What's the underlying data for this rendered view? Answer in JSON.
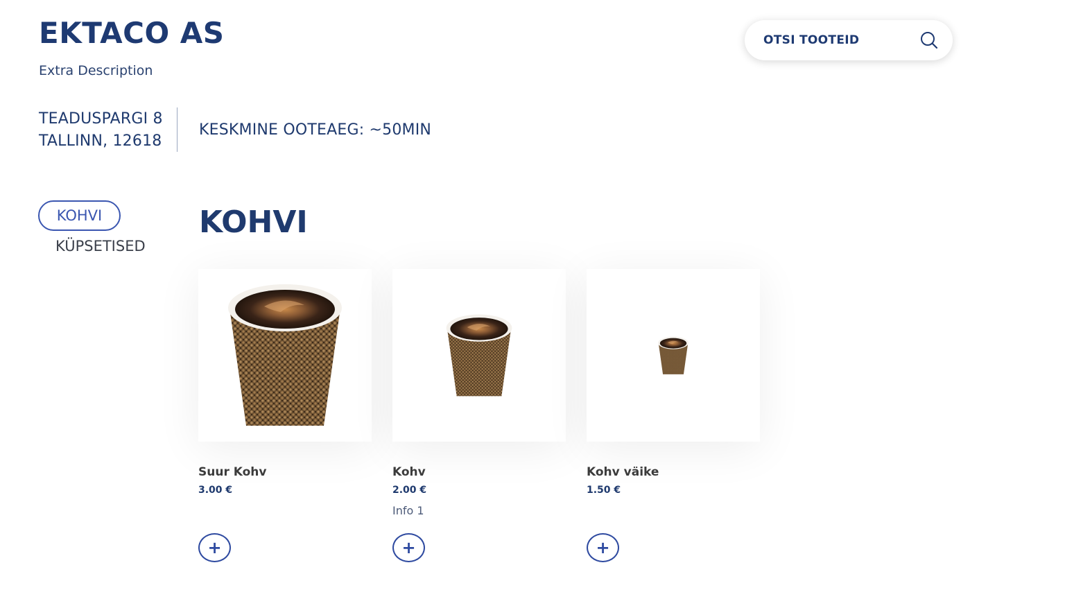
{
  "header": {
    "title": "EKTACO AS",
    "description": "Extra Description"
  },
  "search": {
    "label": "OTSI TOOTEID",
    "icon": "search-icon"
  },
  "location": {
    "address_line1": "TEADUSPARGI 8",
    "address_line2": "TALLINN, 12618",
    "wait_time": "KESKMINE OOTEAEG: ~50MIN"
  },
  "categories": [
    {
      "label": "KOHVI",
      "active": true
    },
    {
      "label": "KÜPSETISED",
      "active": false
    }
  ],
  "section": {
    "title": "KOHVI"
  },
  "products": [
    {
      "name": "Suur Kohv",
      "price": "3.00 €",
      "info": "",
      "image_icon": "coffee-cup-icon",
      "add_label": "+"
    },
    {
      "name": "Kohv",
      "price": "2.00 €",
      "info": "Info 1",
      "image_icon": "coffee-cup-icon",
      "add_label": "+"
    },
    {
      "name": "Kohv väike",
      "price": "1.50 €",
      "info": "",
      "image_icon": "coffee-cup-icon",
      "add_label": "+"
    }
  ],
  "colors": {
    "brand": "#1e3a72",
    "accent": "#3a56b0",
    "cup_sleeve": "#7a5a38",
    "coffee": "#3b2418"
  }
}
